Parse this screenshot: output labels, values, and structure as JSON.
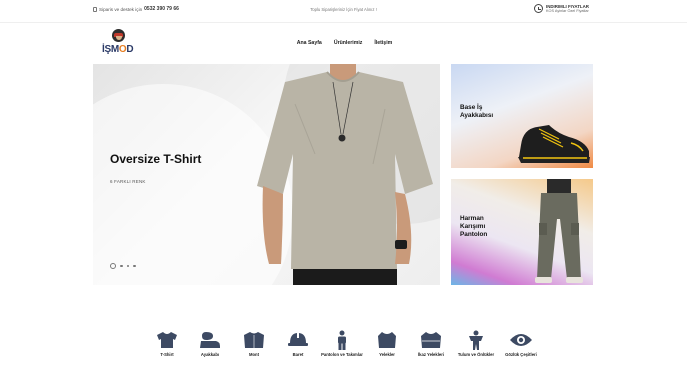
{
  "topbar": {
    "phone_prefix": "Siparis ve destek için",
    "phone_number": "0532 390 79 66",
    "center_message": "Toplu Siparişleriniz İçin Fiyat Alınız !",
    "pricing_title": "INDIRIMLI FIYATLAR",
    "pricing_subtitle": "KOS Ayinlar Özel Fiyatlar"
  },
  "logo": {
    "text_left": "İŞM",
    "text_accent": "O",
    "text_right": "D"
  },
  "nav": {
    "items": [
      "Ana Sayfa",
      "Ürünlerimiz",
      "İletişim"
    ]
  },
  "hero": {
    "title": "Oversize T-Shirt",
    "subtitle": "6 FARKLI RENK",
    "slides": 4,
    "active_slide": 1
  },
  "promos": [
    {
      "title": "Base İş Ayakkabısı"
    },
    {
      "title": "Harman Karışımı Pantolon"
    }
  ],
  "categories": [
    {
      "label": "T-Shirt",
      "icon": "tshirt-icon"
    },
    {
      "label": "Ayakkabı",
      "icon": "shoes-icon"
    },
    {
      "label": "Mont",
      "icon": "jacket-icon"
    },
    {
      "label": "Baret",
      "icon": "helmet-icon"
    },
    {
      "label": "Pantolon ve Takımlar",
      "icon": "person-icon"
    },
    {
      "label": "Yelekler",
      "icon": "vest-icon"
    },
    {
      "label": "İkaz Yelekleri",
      "icon": "safety-vest-icon"
    },
    {
      "label": "Tulum ve Önlükler",
      "icon": "overall-icon"
    },
    {
      "label": "Gözlük Çeşitleri",
      "icon": "eye-icon"
    }
  ],
  "colors": {
    "accent": "#2b3a67",
    "logo_accent": "#e67e22",
    "icon_color": "#3d4a63"
  }
}
